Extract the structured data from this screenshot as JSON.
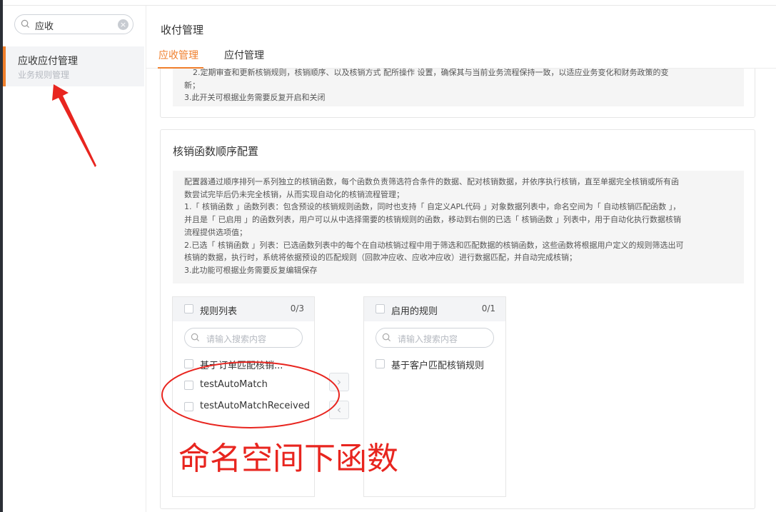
{
  "sidebar": {
    "search_value": "应收",
    "items": [
      {
        "label": "应收应付管理",
        "sublabel": "业务规则管理"
      }
    ]
  },
  "header": {
    "title": "收付管理",
    "tabs": [
      {
        "label": "应收管理",
        "active": true
      },
      {
        "label": "应付管理",
        "active": false
      }
    ]
  },
  "section1": {
    "lines": [
      "2.定期审查和更新核销规则，核销顺序、以及核销方式 配所操作 设置，确保其与当前业务流程保持一致，以适应业务变化和财务政策的变",
      "新；",
      "3.此开关可根据业务需要反复开启和关闭"
    ]
  },
  "section2": {
    "title": "核销函数顺序配置",
    "lines": [
      "配置器通过顺序排列一系列独立的核销函数，每个函数负责筛选符合条件的数据、配对核销数据，并依序执行核销，直至单据完全核销或所有函",
      "数尝试完毕后仍未完全核销，从而实现自动化的核销流程管理；",
      "1.「 核销函数 」函数列表：包含预设的核销规则函数，同时也支持「 自定义APL代码 」对象数据列表中，命名空间为「 自动核销匹配函数 」，",
      "并且是「 已启用 」的函数列表，用户可以从中选择需要的核销规则的函数，移动到右侧的已选「 核销函数 」列表中，用于自动化执行数据核销",
      "流程提供选项值；",
      "2.已选「 核销函数 」列表：已选函数列表中的每个在自动核销过程中用于筛选和匹配数据的核销函数，这些函数将根据用户定义的规则筛选出可",
      "核销的数据，执行时，系统将依据预设的匹配规则（回款冲应收、应收冲应收）进行数据匹配，并自动完成核销；",
      "3.此功能可根据业务需要反复编辑保存"
    ]
  },
  "transfer": {
    "left": {
      "title": "规则列表",
      "count": "0/3",
      "placeholder": "请输入搜索内容",
      "items": [
        "基于订单匹配核销...",
        "testAutoMatch",
        "testAutoMatchReceived"
      ]
    },
    "right": {
      "title": "启用的规则",
      "count": "0/1",
      "placeholder": "请输入搜索内容",
      "items": [
        "基于客户匹配核销规则"
      ]
    },
    "move_right_symbol": "›",
    "move_left_symbol": "‹"
  },
  "annotation": {
    "text": "命名空间下函数",
    "color": "#e8251f"
  },
  "colors": {
    "accent": "#f07f2c",
    "sidebar_dark": "#2b2f36"
  }
}
